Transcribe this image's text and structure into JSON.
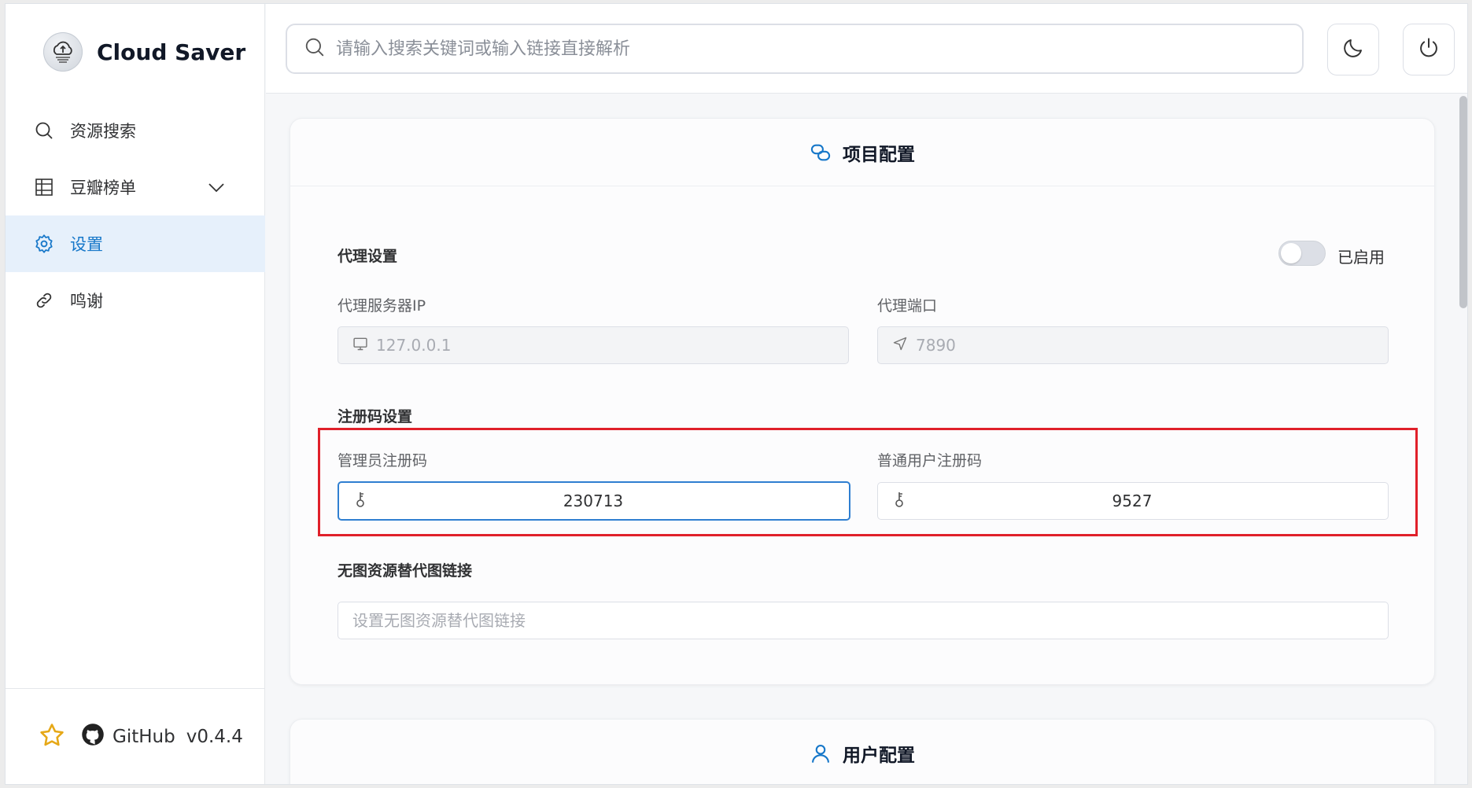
{
  "brand": {
    "name": "Cloud Saver"
  },
  "nav": {
    "items": [
      {
        "label": "资源搜索",
        "icon": "search-icon"
      },
      {
        "label": "豆瓣榜单",
        "icon": "grid-icon",
        "expandable": true
      },
      {
        "label": "设置",
        "icon": "gear-icon",
        "active": true
      },
      {
        "label": "鸣谢",
        "icon": "link-icon"
      }
    ]
  },
  "footer": {
    "github": "GitHub",
    "version": "v0.4.4"
  },
  "search": {
    "placeholder": "请输入搜索关键词或输入链接直接解析"
  },
  "project_config": {
    "title": "项目配置",
    "proxy": {
      "title": "代理设置",
      "toggle_label": "已启用",
      "ip_label": "代理服务器IP",
      "ip_value": "127.0.0.1",
      "port_label": "代理端口",
      "port_value": "7890"
    },
    "registration": {
      "title": "注册码设置",
      "admin_label": "管理员注册码",
      "admin_value": "230713",
      "user_label": "普通用户注册码",
      "user_value": "9527"
    },
    "placeholder_image": {
      "title": "无图资源替代图链接",
      "placeholder": "设置无图资源替代图链接"
    }
  },
  "user_config": {
    "title": "用户配置"
  },
  "colors": {
    "accent": "#1677c9",
    "highlight": "#e0202a",
    "active_bg": "#e6f0fb"
  }
}
